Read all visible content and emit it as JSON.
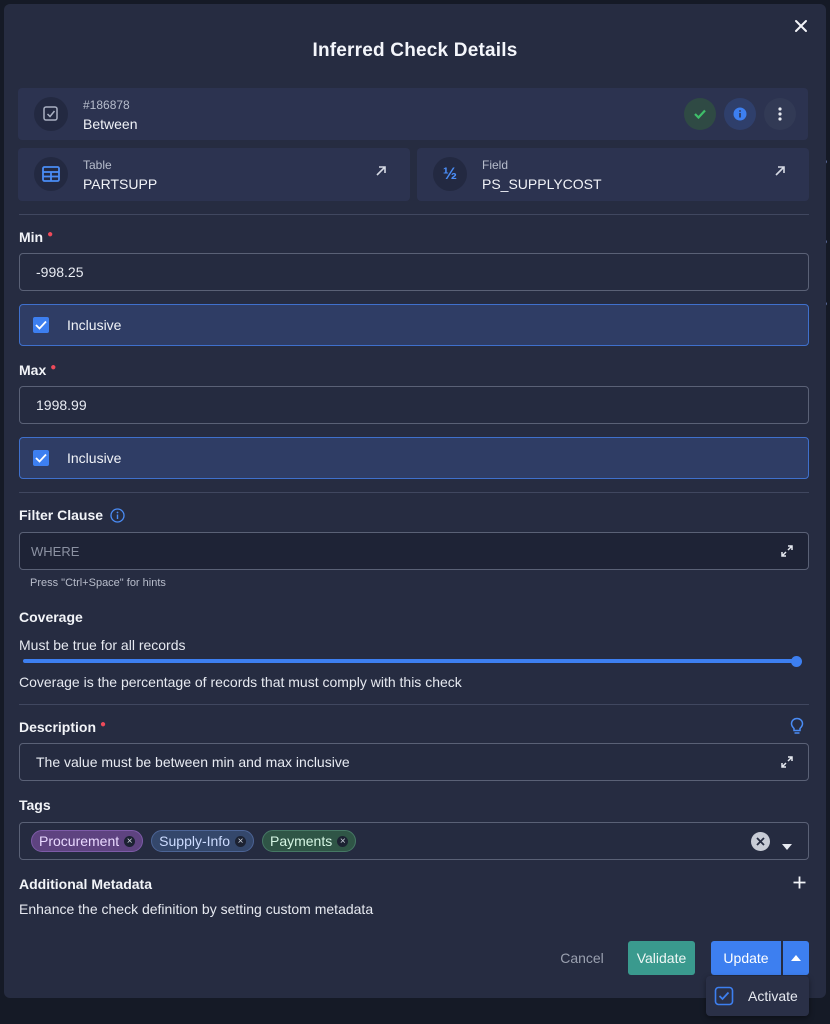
{
  "modal": {
    "title": "Inferred Check Details"
  },
  "check": {
    "id": "#186878",
    "type": "Between"
  },
  "table_card": {
    "label": "Table",
    "value": "PARTSUPP"
  },
  "field_card": {
    "label": "Field",
    "value": "PS_SUPPLYCOST",
    "icon_glyph": "½"
  },
  "min": {
    "label": "Min",
    "value": "-998.25",
    "inclusive_label": "Inclusive",
    "inclusive": true
  },
  "max": {
    "label": "Max",
    "value": "1998.99",
    "inclusive_label": "Inclusive",
    "inclusive": true
  },
  "filter": {
    "label": "Filter Clause",
    "placeholder": "WHERE",
    "hint": "Press \"Ctrl+Space\" for hints"
  },
  "coverage": {
    "label": "Coverage",
    "value_text": "Must be true for all records",
    "value": 1.0,
    "help": "Coverage is the percentage of records that must comply with this check"
  },
  "description": {
    "label": "Description",
    "value": "The value must be between min and max inclusive"
  },
  "tags": {
    "label": "Tags",
    "items": [
      {
        "name": "Procurement",
        "color": "#5e4380"
      },
      {
        "name": "Supply-Info",
        "color": "#34476b"
      },
      {
        "name": "Payments",
        "color": "#2f5546"
      }
    ]
  },
  "metadata": {
    "label": "Additional Metadata",
    "help": "Enhance the check definition by setting custom metadata"
  },
  "footer": {
    "cancel_label": "Cancel",
    "validate_label": "Validate",
    "update_label": "Update",
    "activate_label": "Activate"
  },
  "colors": {
    "accent": "#3d7ff0",
    "validate": "#3a9a8e",
    "status_ok": "#3fbf6a",
    "required": "#ee4a5a"
  }
}
